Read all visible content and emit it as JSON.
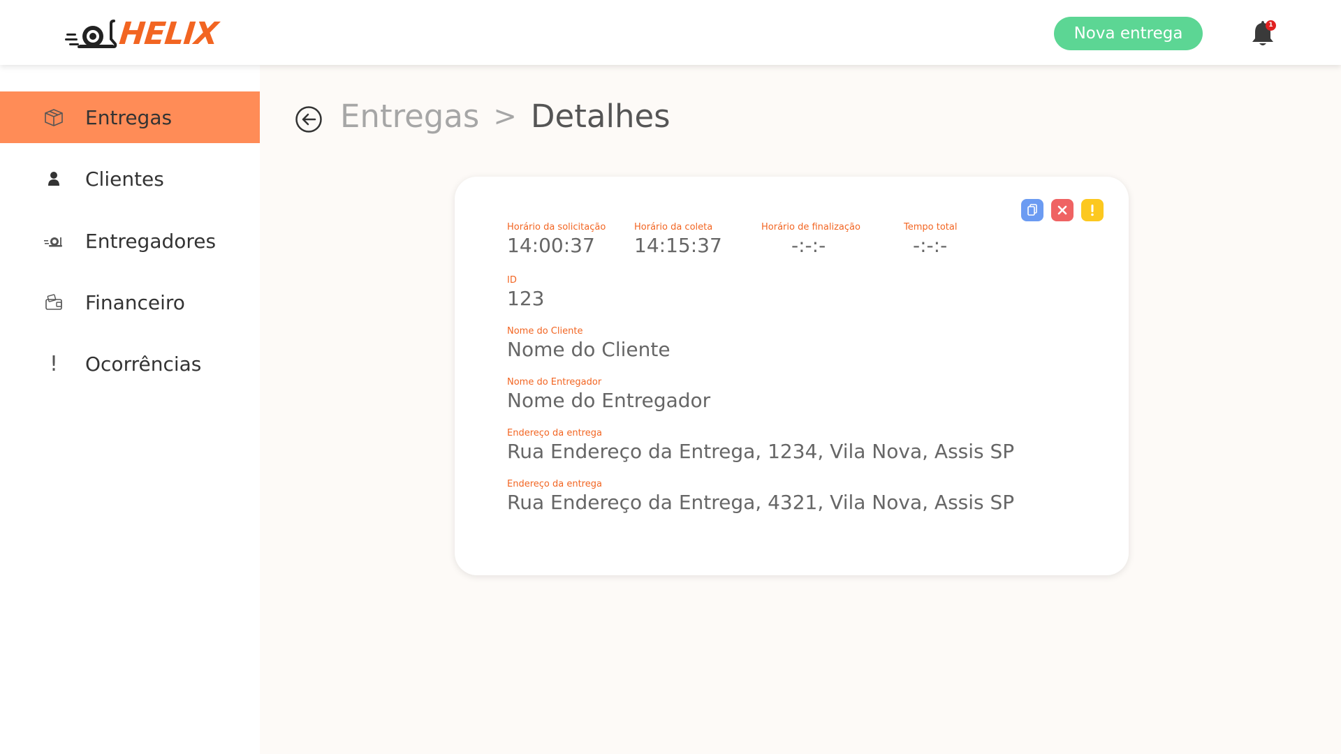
{
  "header": {
    "logo_text": "HELIX",
    "new_delivery_label": "Nova entrega",
    "notification_count": "1"
  },
  "sidebar": {
    "items": [
      {
        "label": "Entregas",
        "icon": "package-icon",
        "active": true
      },
      {
        "label": "Clientes",
        "icon": "user-icon",
        "active": false
      },
      {
        "label": "Entregadores",
        "icon": "snail-icon",
        "active": false
      },
      {
        "label": "Financeiro",
        "icon": "wallet-icon",
        "active": false
      },
      {
        "label": "Ocorrências",
        "icon": "exclamation-icon",
        "active": false
      }
    ]
  },
  "breadcrumb": {
    "parent": "Entregas",
    "separator": ">",
    "current": "Detalhes"
  },
  "details": {
    "request_time_label": "Horário da solicitação",
    "request_time": "14:00:37",
    "pickup_time_label": "Horário da coleta",
    "pickup_time": "14:15:37",
    "finish_time_label": "Horário de finalização",
    "finish_time": "-:-:-",
    "total_time_label": "Tempo total",
    "total_time": "-:-:-",
    "id_label": "ID",
    "id": "123",
    "client_label": "Nome do Cliente",
    "client": "Nome do Cliente",
    "courier_label": "Nome do Entregador",
    "courier": "Nome do Entregador",
    "address1_label": "Endereço da entrega",
    "address1": "Rua Endereço da Entrega, 1234, Vila Nova, Assis SP",
    "address2_label": "Endereço da entrega",
    "address2": "Rua Endereço da Entrega, 4321, Vila Nova, Assis SP"
  },
  "colors": {
    "accent": "#f26522",
    "active_nav": "#ff8c57",
    "primary_button": "#5cd694",
    "copy_button": "#6b9bf2",
    "cancel_button": "#ef6363",
    "warning_button": "#fcc81f"
  }
}
